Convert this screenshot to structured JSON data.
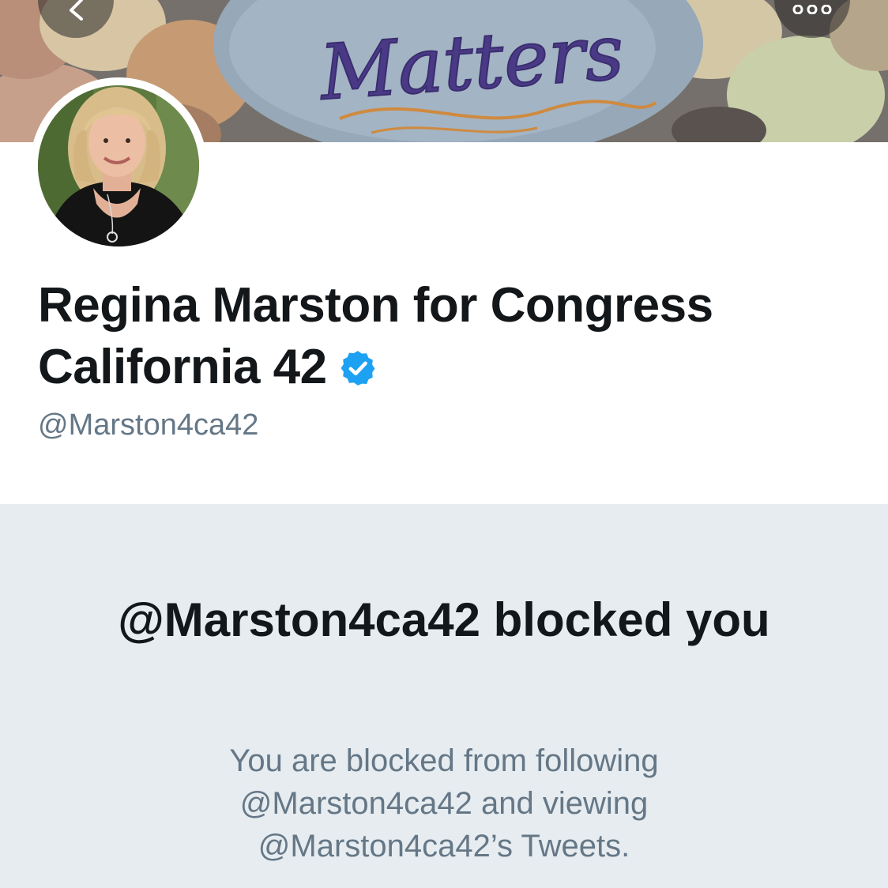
{
  "banner": {
    "painted_text": "Matters",
    "back_icon": "chevron-left-icon",
    "more_icon": "more-dots-icon"
  },
  "profile": {
    "name_line1": "Regina Marston for Congress",
    "name_line2": "California 42",
    "verified_icon": "verified-badge-icon",
    "handle": "@Marston4ca42"
  },
  "blocked": {
    "title": "@Marston4ca42 blocked you",
    "description_line1": "You are blocked from following",
    "description_line2": "@Marston4ca42 and viewing",
    "description_line3": "@Marston4ca42’s Tweets."
  },
  "colors": {
    "verified_blue": "#1da1f2",
    "text_primary": "#14171a",
    "text_secondary": "#657786",
    "blocked_background": "#e6ecf0"
  }
}
